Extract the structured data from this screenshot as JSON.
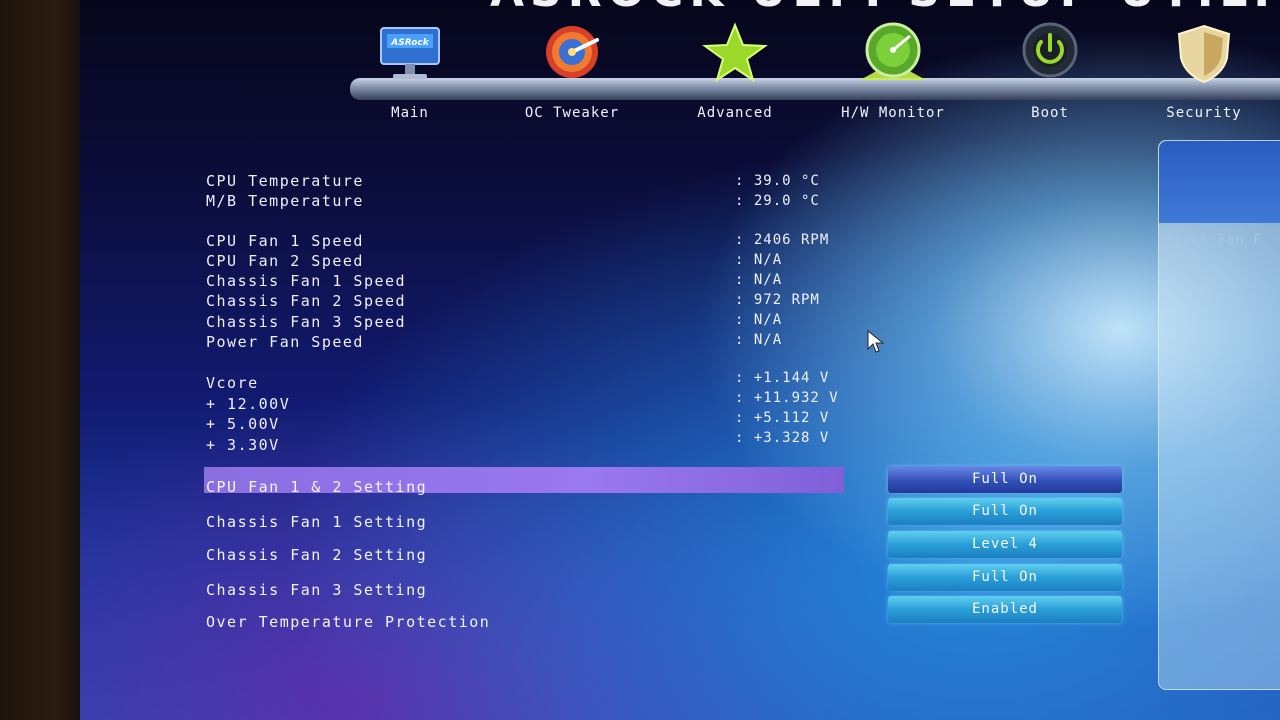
{
  "header": {
    "title": "ASROCK UEFI SETUP UTILITY"
  },
  "nav": [
    {
      "label": "Main",
      "icon": "monitor-icon"
    },
    {
      "label": "OC Tweaker",
      "icon": "speedometer-icon"
    },
    {
      "label": "Advanced",
      "icon": "star-icon"
    },
    {
      "label": "H/W Monitor",
      "icon": "radar-icon"
    },
    {
      "label": "Boot",
      "icon": "power-icon"
    },
    {
      "label": "Security",
      "icon": "shield-icon"
    }
  ],
  "monitor": {
    "temperatures": [
      {
        "label": "CPU Temperature",
        "value": ": 39.0 °C"
      },
      {
        "label": "M/B Temperature",
        "value": ": 29.0 °C"
      }
    ],
    "fans": [
      {
        "label": "CPU Fan 1 Speed",
        "value": ": 2406 RPM"
      },
      {
        "label": "CPU Fan 2 Speed",
        "value": ": N/A"
      },
      {
        "label": "Chassis Fan 1 Speed",
        "value": ": N/A"
      },
      {
        "label": "Chassis Fan 2 Speed",
        "value": ": 972 RPM"
      },
      {
        "label": "Chassis Fan 3 Speed",
        "value": ": N/A"
      },
      {
        "label": "Power Fan Speed",
        "value": ": N/A"
      }
    ],
    "voltages": [
      {
        "label": "Vcore",
        "value": ": +1.144 V"
      },
      {
        "label": "+ 12.00V",
        "value": ": +11.932 V"
      },
      {
        "label": "+ 5.00V",
        "value": ": +5.112 V"
      },
      {
        "label": "+ 3.30V",
        "value": ": +3.328 V"
      }
    ]
  },
  "settings": [
    {
      "label": "CPU Fan 1 & 2 Setting",
      "value": "Full On"
    },
    {
      "label": "Chassis Fan 1 Setting",
      "value": "Full On"
    },
    {
      "label": "Chassis Fan 2 Setting",
      "value": "Level 4"
    },
    {
      "label": "Chassis Fan 3 Setting",
      "value": "Full On"
    },
    {
      "label": "Over Temperature Protection",
      "value": "Enabled"
    }
  ],
  "side_panel": {
    "text": "Quiet Fan F"
  },
  "colors": {
    "highlight": "#9a78f0",
    "button": "#2a9ed8",
    "text": "#eef0ff"
  }
}
